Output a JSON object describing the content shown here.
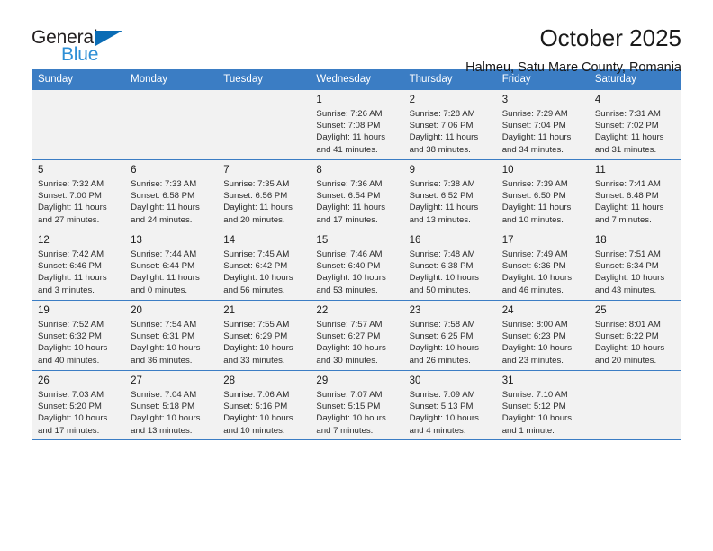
{
  "brand": {
    "name_part1": "General",
    "name_part2": "Blue",
    "triangle_color": "#0a6cb5",
    "blue_color": "#2e8fd6"
  },
  "header": {
    "title": "October 2025",
    "subtitle": "Halmeu, Satu Mare County, Romania"
  },
  "theme": {
    "header_row_bg": "#3b7dc4",
    "header_row_text": "#ffffff",
    "cell_shaded_bg": "#f2f2f2",
    "grid_line": "#3b7dc4"
  },
  "weekdays": [
    "Sunday",
    "Monday",
    "Tuesday",
    "Wednesday",
    "Thursday",
    "Friday",
    "Saturday"
  ],
  "weeks": [
    [
      {
        "day": "",
        "sunrise": "",
        "sunset": "",
        "daylight1": "",
        "daylight2": "",
        "empty": true
      },
      {
        "day": "",
        "sunrise": "",
        "sunset": "",
        "daylight1": "",
        "daylight2": "",
        "empty": true
      },
      {
        "day": "",
        "sunrise": "",
        "sunset": "",
        "daylight1": "",
        "daylight2": "",
        "empty": true
      },
      {
        "day": "1",
        "sunrise": "Sunrise: 7:26 AM",
        "sunset": "Sunset: 7:08 PM",
        "daylight1": "Daylight: 11 hours",
        "daylight2": "and 41 minutes.",
        "empty": false
      },
      {
        "day": "2",
        "sunrise": "Sunrise: 7:28 AM",
        "sunset": "Sunset: 7:06 PM",
        "daylight1": "Daylight: 11 hours",
        "daylight2": "and 38 minutes.",
        "empty": false
      },
      {
        "day": "3",
        "sunrise": "Sunrise: 7:29 AM",
        "sunset": "Sunset: 7:04 PM",
        "daylight1": "Daylight: 11 hours",
        "daylight2": "and 34 minutes.",
        "empty": false
      },
      {
        "day": "4",
        "sunrise": "Sunrise: 7:31 AM",
        "sunset": "Sunset: 7:02 PM",
        "daylight1": "Daylight: 11 hours",
        "daylight2": "and 31 minutes.",
        "empty": false
      }
    ],
    [
      {
        "day": "5",
        "sunrise": "Sunrise: 7:32 AM",
        "sunset": "Sunset: 7:00 PM",
        "daylight1": "Daylight: 11 hours",
        "daylight2": "and 27 minutes.",
        "empty": false
      },
      {
        "day": "6",
        "sunrise": "Sunrise: 7:33 AM",
        "sunset": "Sunset: 6:58 PM",
        "daylight1": "Daylight: 11 hours",
        "daylight2": "and 24 minutes.",
        "empty": false
      },
      {
        "day": "7",
        "sunrise": "Sunrise: 7:35 AM",
        "sunset": "Sunset: 6:56 PM",
        "daylight1": "Daylight: 11 hours",
        "daylight2": "and 20 minutes.",
        "empty": false
      },
      {
        "day": "8",
        "sunrise": "Sunrise: 7:36 AM",
        "sunset": "Sunset: 6:54 PM",
        "daylight1": "Daylight: 11 hours",
        "daylight2": "and 17 minutes.",
        "empty": false
      },
      {
        "day": "9",
        "sunrise": "Sunrise: 7:38 AM",
        "sunset": "Sunset: 6:52 PM",
        "daylight1": "Daylight: 11 hours",
        "daylight2": "and 13 minutes.",
        "empty": false
      },
      {
        "day": "10",
        "sunrise": "Sunrise: 7:39 AM",
        "sunset": "Sunset: 6:50 PM",
        "daylight1": "Daylight: 11 hours",
        "daylight2": "and 10 minutes.",
        "empty": false
      },
      {
        "day": "11",
        "sunrise": "Sunrise: 7:41 AM",
        "sunset": "Sunset: 6:48 PM",
        "daylight1": "Daylight: 11 hours",
        "daylight2": "and 7 minutes.",
        "empty": false
      }
    ],
    [
      {
        "day": "12",
        "sunrise": "Sunrise: 7:42 AM",
        "sunset": "Sunset: 6:46 PM",
        "daylight1": "Daylight: 11 hours",
        "daylight2": "and 3 minutes.",
        "empty": false
      },
      {
        "day": "13",
        "sunrise": "Sunrise: 7:44 AM",
        "sunset": "Sunset: 6:44 PM",
        "daylight1": "Daylight: 11 hours",
        "daylight2": "and 0 minutes.",
        "empty": false
      },
      {
        "day": "14",
        "sunrise": "Sunrise: 7:45 AM",
        "sunset": "Sunset: 6:42 PM",
        "daylight1": "Daylight: 10 hours",
        "daylight2": "and 56 minutes.",
        "empty": false
      },
      {
        "day": "15",
        "sunrise": "Sunrise: 7:46 AM",
        "sunset": "Sunset: 6:40 PM",
        "daylight1": "Daylight: 10 hours",
        "daylight2": "and 53 minutes.",
        "empty": false
      },
      {
        "day": "16",
        "sunrise": "Sunrise: 7:48 AM",
        "sunset": "Sunset: 6:38 PM",
        "daylight1": "Daylight: 10 hours",
        "daylight2": "and 50 minutes.",
        "empty": false
      },
      {
        "day": "17",
        "sunrise": "Sunrise: 7:49 AM",
        "sunset": "Sunset: 6:36 PM",
        "daylight1": "Daylight: 10 hours",
        "daylight2": "and 46 minutes.",
        "empty": false
      },
      {
        "day": "18",
        "sunrise": "Sunrise: 7:51 AM",
        "sunset": "Sunset: 6:34 PM",
        "daylight1": "Daylight: 10 hours",
        "daylight2": "and 43 minutes.",
        "empty": false
      }
    ],
    [
      {
        "day": "19",
        "sunrise": "Sunrise: 7:52 AM",
        "sunset": "Sunset: 6:32 PM",
        "daylight1": "Daylight: 10 hours",
        "daylight2": "and 40 minutes.",
        "empty": false
      },
      {
        "day": "20",
        "sunrise": "Sunrise: 7:54 AM",
        "sunset": "Sunset: 6:31 PM",
        "daylight1": "Daylight: 10 hours",
        "daylight2": "and 36 minutes.",
        "empty": false
      },
      {
        "day": "21",
        "sunrise": "Sunrise: 7:55 AM",
        "sunset": "Sunset: 6:29 PM",
        "daylight1": "Daylight: 10 hours",
        "daylight2": "and 33 minutes.",
        "empty": false
      },
      {
        "day": "22",
        "sunrise": "Sunrise: 7:57 AM",
        "sunset": "Sunset: 6:27 PM",
        "daylight1": "Daylight: 10 hours",
        "daylight2": "and 30 minutes.",
        "empty": false
      },
      {
        "day": "23",
        "sunrise": "Sunrise: 7:58 AM",
        "sunset": "Sunset: 6:25 PM",
        "daylight1": "Daylight: 10 hours",
        "daylight2": "and 26 minutes.",
        "empty": false
      },
      {
        "day": "24",
        "sunrise": "Sunrise: 8:00 AM",
        "sunset": "Sunset: 6:23 PM",
        "daylight1": "Daylight: 10 hours",
        "daylight2": "and 23 minutes.",
        "empty": false
      },
      {
        "day": "25",
        "sunrise": "Sunrise: 8:01 AM",
        "sunset": "Sunset: 6:22 PM",
        "daylight1": "Daylight: 10 hours",
        "daylight2": "and 20 minutes.",
        "empty": false
      }
    ],
    [
      {
        "day": "26",
        "sunrise": "Sunrise: 7:03 AM",
        "sunset": "Sunset: 5:20 PM",
        "daylight1": "Daylight: 10 hours",
        "daylight2": "and 17 minutes.",
        "empty": false
      },
      {
        "day": "27",
        "sunrise": "Sunrise: 7:04 AM",
        "sunset": "Sunset: 5:18 PM",
        "daylight1": "Daylight: 10 hours",
        "daylight2": "and 13 minutes.",
        "empty": false
      },
      {
        "day": "28",
        "sunrise": "Sunrise: 7:06 AM",
        "sunset": "Sunset: 5:16 PM",
        "daylight1": "Daylight: 10 hours",
        "daylight2": "and 10 minutes.",
        "empty": false
      },
      {
        "day": "29",
        "sunrise": "Sunrise: 7:07 AM",
        "sunset": "Sunset: 5:15 PM",
        "daylight1": "Daylight: 10 hours",
        "daylight2": "and 7 minutes.",
        "empty": false
      },
      {
        "day": "30",
        "sunrise": "Sunrise: 7:09 AM",
        "sunset": "Sunset: 5:13 PM",
        "daylight1": "Daylight: 10 hours",
        "daylight2": "and 4 minutes.",
        "empty": false
      },
      {
        "day": "31",
        "sunrise": "Sunrise: 7:10 AM",
        "sunset": "Sunset: 5:12 PM",
        "daylight1": "Daylight: 10 hours",
        "daylight2": "and 1 minute.",
        "empty": false
      },
      {
        "day": "",
        "sunrise": "",
        "sunset": "",
        "daylight1": "",
        "daylight2": "",
        "empty": true
      }
    ]
  ]
}
